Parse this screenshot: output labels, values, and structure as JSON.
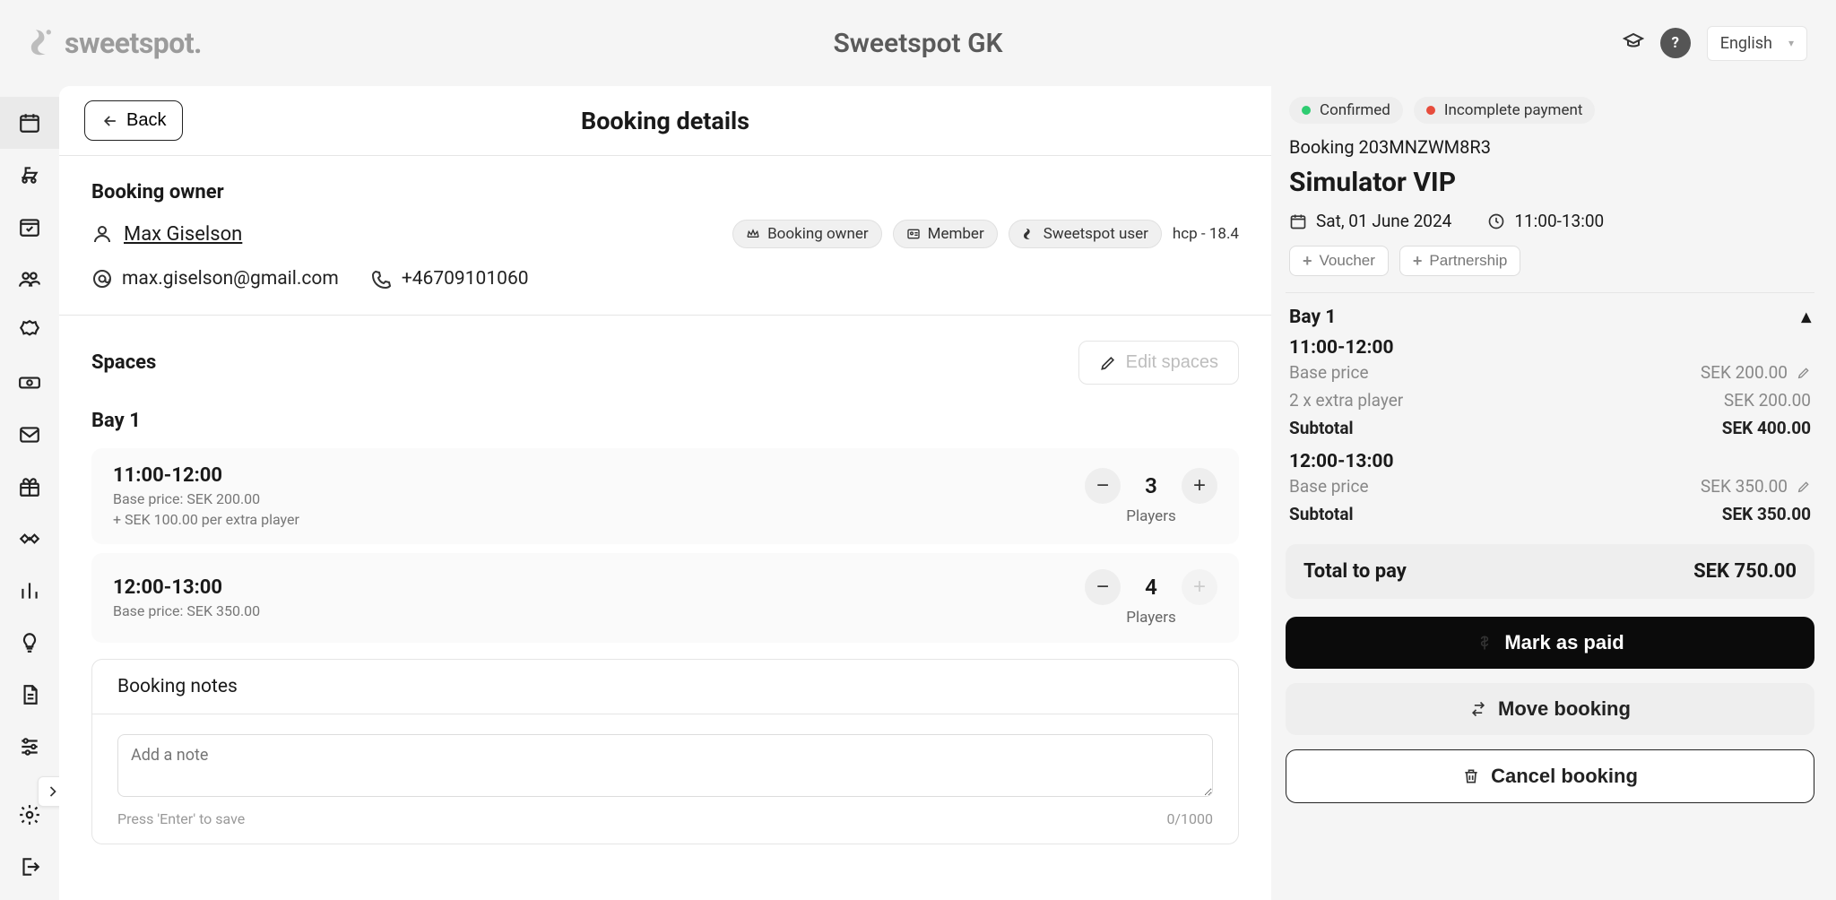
{
  "topbar": {
    "brand": "sweetspot.",
    "app_title": "Sweetspot GK",
    "language": "English"
  },
  "sidebar": {
    "items": [
      {
        "name": "calendar-icon",
        "active": true
      },
      {
        "name": "golf-cart-icon"
      },
      {
        "name": "schedule-icon"
      },
      {
        "name": "people-icon"
      },
      {
        "name": "badge-icon"
      },
      {
        "name": "cash-icon"
      },
      {
        "name": "mail-icon"
      },
      {
        "name": "gift-icon"
      },
      {
        "name": "handshake-icon"
      },
      {
        "name": "stats-icon"
      },
      {
        "name": "bulb-icon"
      },
      {
        "name": "page-icon"
      },
      {
        "name": "sliders-icon"
      },
      {
        "name": "settings-icon"
      },
      {
        "name": "logout-icon"
      }
    ]
  },
  "header": {
    "back_label": "Back",
    "page_title": "Booking details"
  },
  "owner": {
    "section_title": "Booking owner",
    "name": "Max Giselson",
    "email": "max.giselson@gmail.com",
    "phone": "+46709101060",
    "pills": {
      "owner": "Booking owner",
      "member": "Member",
      "sweetspot": "Sweetspot user"
    },
    "hcp": "hcp - 18.4"
  },
  "spaces": {
    "section_title": "Spaces",
    "edit_label": "Edit spaces",
    "bay_title": "Bay 1",
    "players_label": "Players",
    "slots": [
      {
        "time": "11:00-12:00",
        "base_price_label": "Base price: SEK 200.00",
        "extra_label": "+ SEK 100.00 per extra player",
        "count": "3",
        "plus_disabled": false
      },
      {
        "time": "12:00-13:00",
        "base_price_label": "Base price: SEK 350.00",
        "extra_label": "",
        "count": "4",
        "plus_disabled": true
      }
    ]
  },
  "notes": {
    "title": "Booking notes",
    "placeholder": "Add a note",
    "hint": "Press 'Enter' to save",
    "counter": "0/1000"
  },
  "summary": {
    "statuses": {
      "confirmed": "Confirmed",
      "incomplete": "Incomplete payment"
    },
    "booking_id_label": "Booking 203MNZWM8R3",
    "product": "Simulator VIP",
    "date": "Sat, 01 June 2024",
    "time": "11:00-13:00",
    "voucher": "Voucher",
    "partnership": "Partnership",
    "bay_title": "Bay 1",
    "blocks": [
      {
        "time": "11:00-12:00",
        "lines": [
          {
            "label": "Base price",
            "value": "SEK 200.00",
            "editable": true
          },
          {
            "label": "2 x extra player",
            "value": "SEK 200.00",
            "editable": false
          }
        ],
        "subtotal_label": "Subtotal",
        "subtotal_value": "SEK 400.00"
      },
      {
        "time": "12:00-13:00",
        "lines": [
          {
            "label": "Base price",
            "value": "SEK 350.00",
            "editable": true
          }
        ],
        "subtotal_label": "Subtotal",
        "subtotal_value": "SEK 350.00"
      }
    ],
    "total_label": "Total to pay",
    "total_value": "SEK 750.00",
    "mark_paid": "Mark as paid",
    "move": "Move booking",
    "cancel": "Cancel booking"
  }
}
